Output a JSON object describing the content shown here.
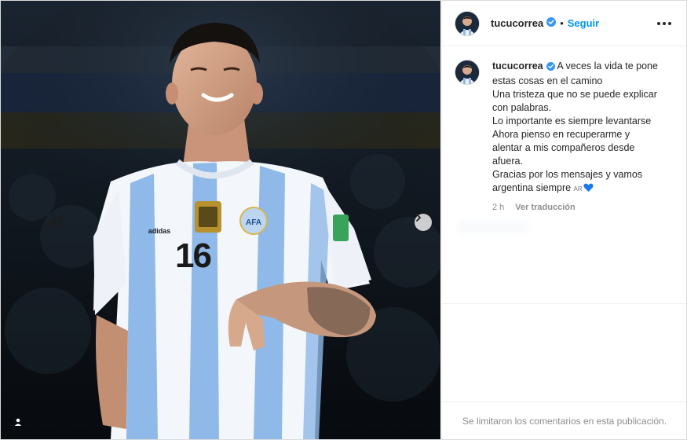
{
  "header": {
    "username": "tucucorrea",
    "separator": "•",
    "follow_label": "Seguir",
    "avatar_icon": "profile-avatar",
    "verified_icon": "verified-badge-icon",
    "more_icon": "more-options-icon"
  },
  "media": {
    "jersey_number": "16",
    "next_icon": "chevron-right-icon",
    "tag_icon": "user-tag-icon"
  },
  "caption": {
    "username": "tucucorrea",
    "lines": [
      "A veces la vida te pone",
      "estas cosas en el camino",
      "Una tristeza que no se puede explicar",
      "con palabras.",
      "Lo importante es siempre levantarse",
      "Ahora pienso en recuperarme y",
      "alentar a mis compañeros desde",
      "afuera.",
      "Gracias por los mensajes y vamos",
      "argentina siempre"
    ],
    "flag_text": "AR",
    "heart_icon": "blue-heart-icon",
    "time": "2 h",
    "translate_label": "Ver traducción"
  },
  "footer": {
    "comments_limited": "Se limitaron los comentarios en esta publicación."
  },
  "colors": {
    "accent": "#0095f6",
    "verified": "#3897f0",
    "heart": "#1877f2",
    "muted": "#8e8e8e",
    "text": "#262626"
  }
}
